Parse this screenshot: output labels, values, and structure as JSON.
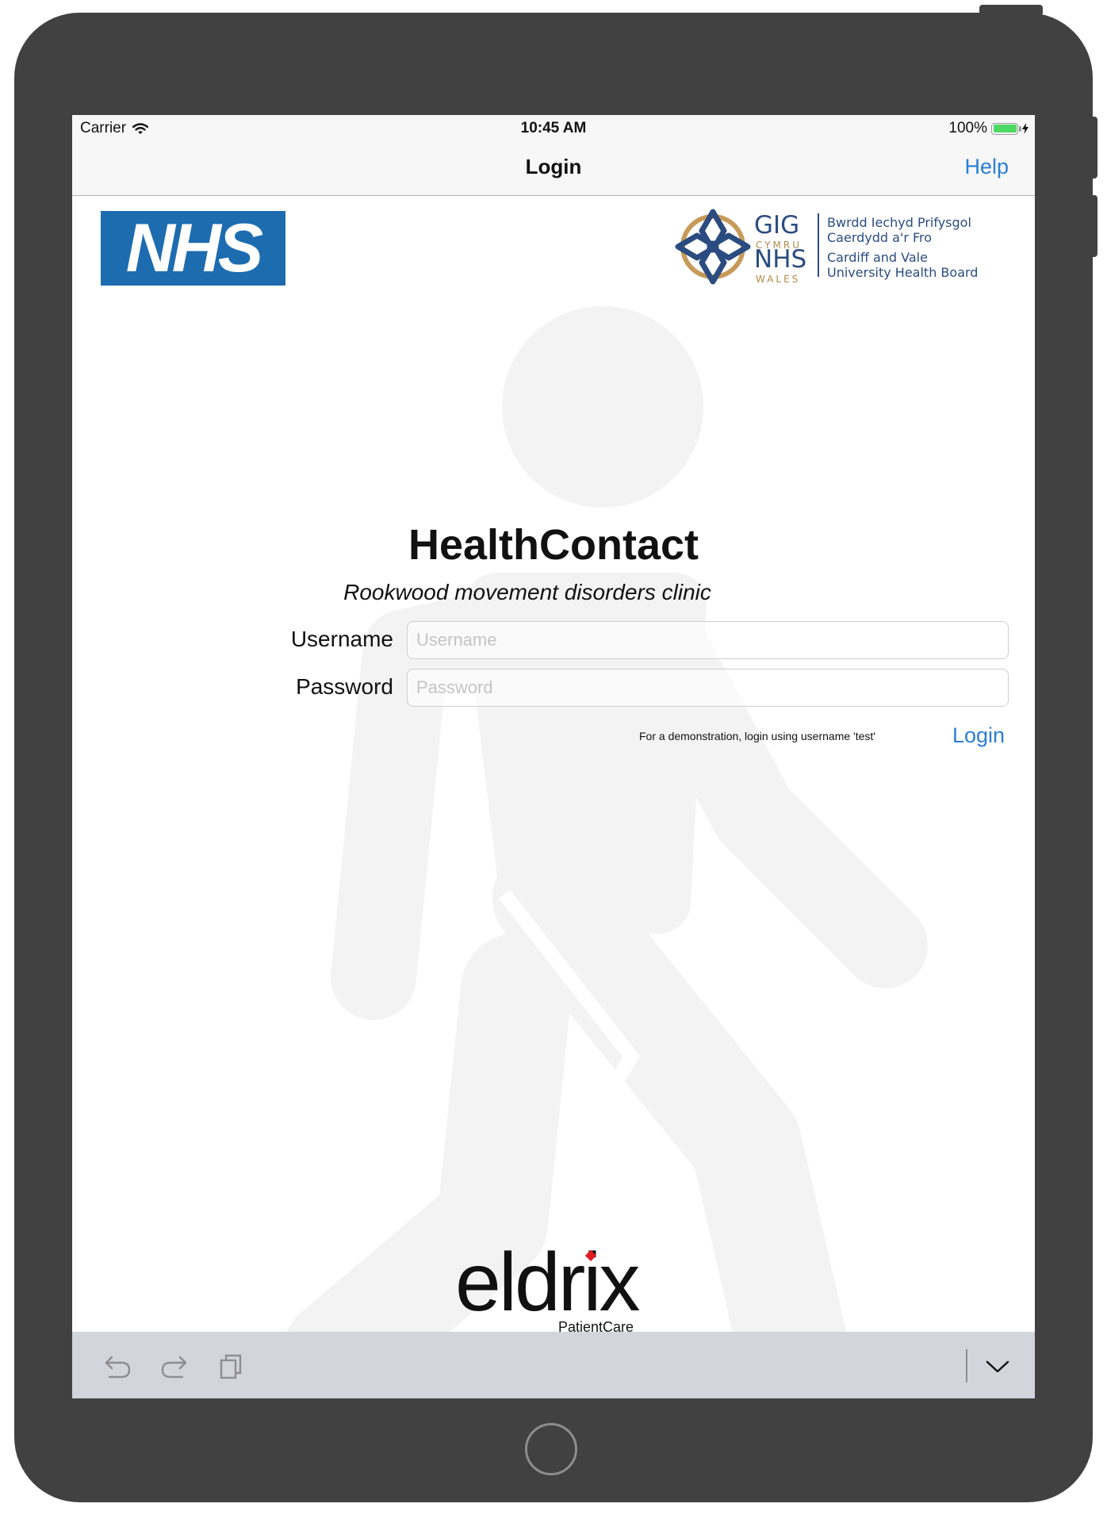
{
  "status_bar": {
    "carrier": "Carrier",
    "time": "10:45 AM",
    "battery_percent": "100%",
    "battery_level": 1.0,
    "battery_color": "#4cd964",
    "wifi_icon": "wifi-icon",
    "charging_icon": "bolt-icon"
  },
  "nav_bar": {
    "title": "Login",
    "help_label": "Help",
    "accent_color": "#2a7fd4"
  },
  "logos": {
    "nhs": "NHS",
    "health_board": {
      "gig": "GIG",
      "cymru": "CYMRU",
      "nhs": "NHS",
      "wales": "WALES",
      "lines": [
        "Bwrdd Iechyd Prifysgol",
        "Caerdydd a'r Fro",
        "Cardiff and Vale",
        "University Health Board"
      ]
    },
    "eldrix": "eldrix",
    "eldrix_sub": "PatientCare"
  },
  "app": {
    "title": "HealthContact",
    "subtitle": "Rookwood movement disorders clinic"
  },
  "form": {
    "username_label": "Username",
    "username_placeholder": "Username",
    "username_value": "",
    "password_label": "Password",
    "password_placeholder": "Password",
    "password_value": "",
    "demo_note": "For a demonstration, login using username 'test'",
    "login_label": "Login"
  },
  "accessory_bar": {
    "icons": [
      "undo-icon",
      "redo-icon",
      "paste-icon",
      "chevron-down-icon"
    ]
  },
  "background": {
    "figure": "walking-person-icon"
  }
}
